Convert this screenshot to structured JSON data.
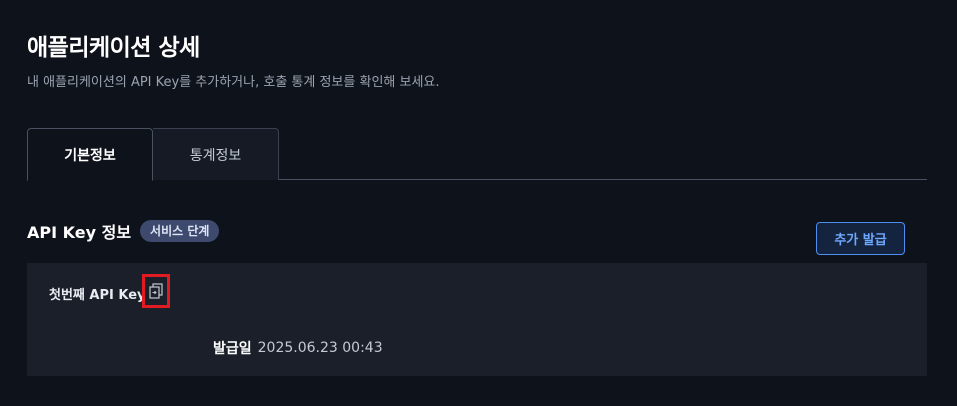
{
  "header": {
    "title": "애플리케이션 상세",
    "subtitle": "내 애플리케이션의 API Key를 추가하거나, 호출 통계 정보를 확인해 보세요."
  },
  "tabs": [
    {
      "label": "기본정보",
      "active": true
    },
    {
      "label": "통계정보",
      "active": false
    }
  ],
  "api_key_section": {
    "title": "API Key 정보",
    "badge": "서비스 단계",
    "add_button_label": "추가 발급",
    "keys": [
      {
        "name": "첫번째 API Key",
        "copy_icon": "copy-icon",
        "issued_label": "발급일",
        "issued_date": "2025.06.23 00:43"
      }
    ]
  },
  "colors": {
    "background": "#0e121a",
    "card": "#1a1f2a",
    "accent": "#4d8ef0",
    "badge": "#3d4a6e",
    "highlight": "#e21b23"
  }
}
